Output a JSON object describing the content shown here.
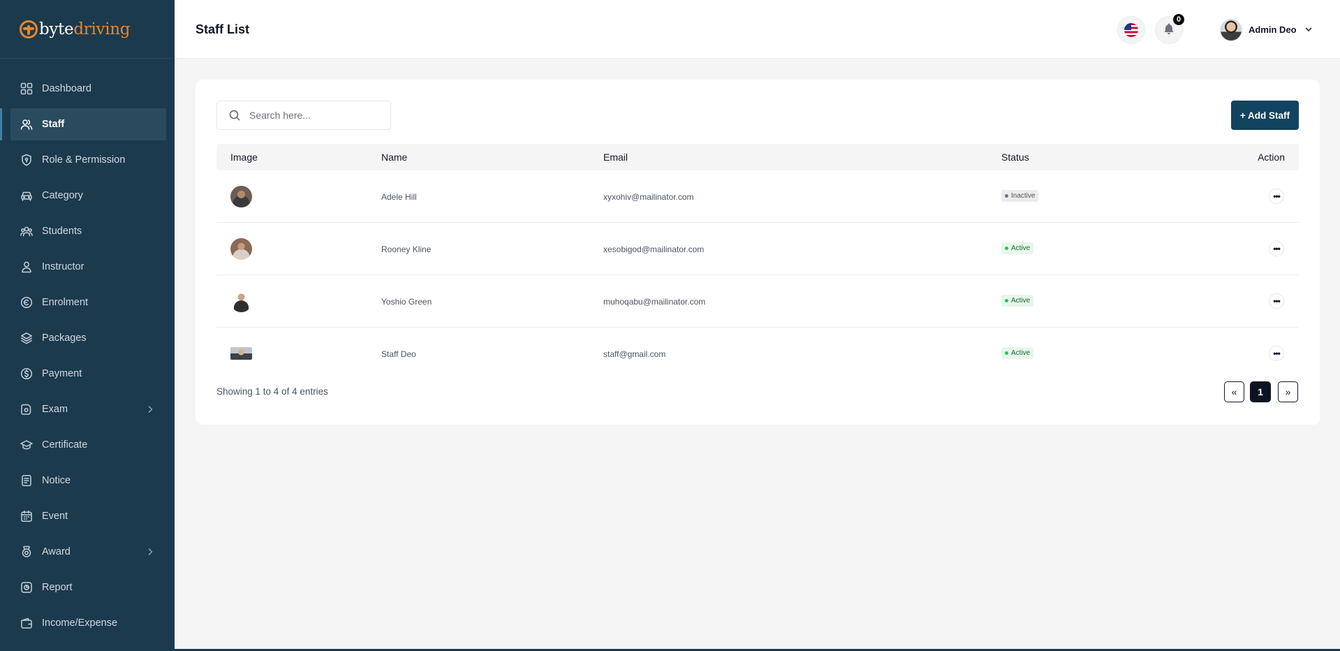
{
  "brand": {
    "part1": "byte",
    "part2": "driving",
    "accent": "#e8862d"
  },
  "sidebar": {
    "items": [
      {
        "label": "Dashboard",
        "icon": "dashboard-icon",
        "active": false
      },
      {
        "label": "Staff",
        "icon": "users-icon",
        "active": true
      },
      {
        "label": "Role & Permission",
        "icon": "shield-icon",
        "active": false
      },
      {
        "label": "Category",
        "icon": "car-icon",
        "active": false
      },
      {
        "label": "Students",
        "icon": "students-icon",
        "active": false
      },
      {
        "label": "Instructor",
        "icon": "user-icon",
        "active": false
      },
      {
        "label": "Enrolment",
        "icon": "enrolment-icon",
        "active": false
      },
      {
        "label": "Packages",
        "icon": "layers-icon",
        "active": false
      },
      {
        "label": "Payment",
        "icon": "dollar-icon",
        "active": false
      },
      {
        "label": "Exam",
        "icon": "exam-icon",
        "active": false,
        "has_submenu": true
      },
      {
        "label": "Certificate",
        "icon": "graduation-cap-icon",
        "active": false
      },
      {
        "label": "Notice",
        "icon": "notice-icon",
        "active": false
      },
      {
        "label": "Event",
        "icon": "calendar-icon",
        "active": false
      },
      {
        "label": "Award",
        "icon": "award-icon",
        "active": false,
        "has_submenu": true
      },
      {
        "label": "Report",
        "icon": "report-icon",
        "active": false
      },
      {
        "label": "Income/Expense",
        "icon": "wallet-icon",
        "active": false
      }
    ]
  },
  "header": {
    "title": "Staff List",
    "language_icon": "us-flag-icon",
    "notification_count": "0",
    "user_name": "Admin Deo"
  },
  "toolbar": {
    "search_placeholder": "Search here...",
    "add_label": "+ Add Staff"
  },
  "table": {
    "columns": [
      "Image",
      "Name",
      "Email",
      "Status",
      "Action"
    ],
    "rows": [
      {
        "name": "Adele Hill",
        "email": "xyxohiv@mailinator.com",
        "status": "Inactive"
      },
      {
        "name": "Rooney Kline",
        "email": "xesobigod@mailinator.com",
        "status": "Active"
      },
      {
        "name": "Yoshio Green",
        "email": "muhoqabu@mailinator.com",
        "status": "Active"
      },
      {
        "name": "Staff Deo",
        "email": "staff@gmail.com",
        "status": "Active"
      }
    ],
    "action_glyph": "•••"
  },
  "footer": {
    "entries_text": "Showing 1 to 4 of 4 entries",
    "prev_label": "«",
    "current_page": "1",
    "next_label": "»"
  },
  "colors": {
    "sidebar_bg": "#1c3a4d",
    "primary_button": "#12435f",
    "active_status": "#22c55e",
    "inactive_status": "#6b7280"
  }
}
